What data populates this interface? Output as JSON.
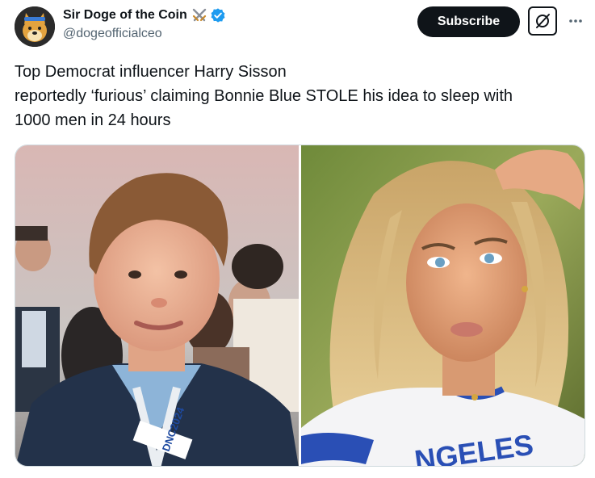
{
  "author": {
    "display_name": "Sir Doge of the Coin",
    "handle": "@dogeofficialceo",
    "name_emoji_icon": "crossed-swords-icon",
    "verified_icon": "verified-badge-icon",
    "verified_color": "#1d9bf0"
  },
  "actions": {
    "subscribe_label": "Subscribe",
    "grok_icon": "grok-icon",
    "more_icon": "more-dots-icon"
  },
  "tweet": {
    "lines": [
      "Top Democrat influencer Harry Sisson",
      "reportedly ‘furious’ claiming Bonnie Blue STOLE his idea to sleep with",
      "1000 men in 24 hours"
    ]
  },
  "media": {
    "left_photo": {
      "lanyard_text": "DNC2024"
    },
    "right_photo": {
      "shirt_text": "NGELES"
    }
  },
  "colors": {
    "text_primary": "#0f1419",
    "text_secondary": "#536471",
    "button_bg": "#0f1419",
    "border": "#cfd9de"
  }
}
